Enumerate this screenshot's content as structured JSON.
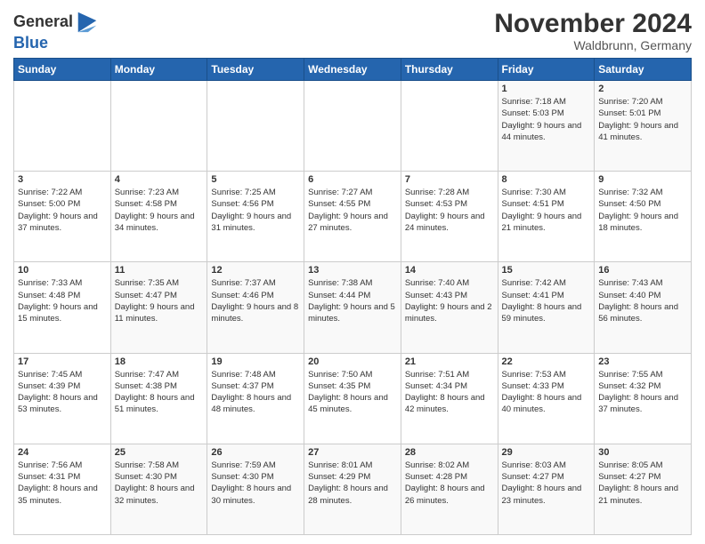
{
  "header": {
    "logo_line1": "General",
    "logo_line2": "Blue",
    "month": "November 2024",
    "location": "Waldbrunn, Germany"
  },
  "days_of_week": [
    "Sunday",
    "Monday",
    "Tuesday",
    "Wednesday",
    "Thursday",
    "Friday",
    "Saturday"
  ],
  "weeks": [
    [
      {
        "day": "",
        "info": ""
      },
      {
        "day": "",
        "info": ""
      },
      {
        "day": "",
        "info": ""
      },
      {
        "day": "",
        "info": ""
      },
      {
        "day": "",
        "info": ""
      },
      {
        "day": "1",
        "info": "Sunrise: 7:18 AM\nSunset: 5:03 PM\nDaylight: 9 hours and 44 minutes."
      },
      {
        "day": "2",
        "info": "Sunrise: 7:20 AM\nSunset: 5:01 PM\nDaylight: 9 hours and 41 minutes."
      }
    ],
    [
      {
        "day": "3",
        "info": "Sunrise: 7:22 AM\nSunset: 5:00 PM\nDaylight: 9 hours and 37 minutes."
      },
      {
        "day": "4",
        "info": "Sunrise: 7:23 AM\nSunset: 4:58 PM\nDaylight: 9 hours and 34 minutes."
      },
      {
        "day": "5",
        "info": "Sunrise: 7:25 AM\nSunset: 4:56 PM\nDaylight: 9 hours and 31 minutes."
      },
      {
        "day": "6",
        "info": "Sunrise: 7:27 AM\nSunset: 4:55 PM\nDaylight: 9 hours and 27 minutes."
      },
      {
        "day": "7",
        "info": "Sunrise: 7:28 AM\nSunset: 4:53 PM\nDaylight: 9 hours and 24 minutes."
      },
      {
        "day": "8",
        "info": "Sunrise: 7:30 AM\nSunset: 4:51 PM\nDaylight: 9 hours and 21 minutes."
      },
      {
        "day": "9",
        "info": "Sunrise: 7:32 AM\nSunset: 4:50 PM\nDaylight: 9 hours and 18 minutes."
      }
    ],
    [
      {
        "day": "10",
        "info": "Sunrise: 7:33 AM\nSunset: 4:48 PM\nDaylight: 9 hours and 15 minutes."
      },
      {
        "day": "11",
        "info": "Sunrise: 7:35 AM\nSunset: 4:47 PM\nDaylight: 9 hours and 11 minutes."
      },
      {
        "day": "12",
        "info": "Sunrise: 7:37 AM\nSunset: 4:46 PM\nDaylight: 9 hours and 8 minutes."
      },
      {
        "day": "13",
        "info": "Sunrise: 7:38 AM\nSunset: 4:44 PM\nDaylight: 9 hours and 5 minutes."
      },
      {
        "day": "14",
        "info": "Sunrise: 7:40 AM\nSunset: 4:43 PM\nDaylight: 9 hours and 2 minutes."
      },
      {
        "day": "15",
        "info": "Sunrise: 7:42 AM\nSunset: 4:41 PM\nDaylight: 8 hours and 59 minutes."
      },
      {
        "day": "16",
        "info": "Sunrise: 7:43 AM\nSunset: 4:40 PM\nDaylight: 8 hours and 56 minutes."
      }
    ],
    [
      {
        "day": "17",
        "info": "Sunrise: 7:45 AM\nSunset: 4:39 PM\nDaylight: 8 hours and 53 minutes."
      },
      {
        "day": "18",
        "info": "Sunrise: 7:47 AM\nSunset: 4:38 PM\nDaylight: 8 hours and 51 minutes."
      },
      {
        "day": "19",
        "info": "Sunrise: 7:48 AM\nSunset: 4:37 PM\nDaylight: 8 hours and 48 minutes."
      },
      {
        "day": "20",
        "info": "Sunrise: 7:50 AM\nSunset: 4:35 PM\nDaylight: 8 hours and 45 minutes."
      },
      {
        "day": "21",
        "info": "Sunrise: 7:51 AM\nSunset: 4:34 PM\nDaylight: 8 hours and 42 minutes."
      },
      {
        "day": "22",
        "info": "Sunrise: 7:53 AM\nSunset: 4:33 PM\nDaylight: 8 hours and 40 minutes."
      },
      {
        "day": "23",
        "info": "Sunrise: 7:55 AM\nSunset: 4:32 PM\nDaylight: 8 hours and 37 minutes."
      }
    ],
    [
      {
        "day": "24",
        "info": "Sunrise: 7:56 AM\nSunset: 4:31 PM\nDaylight: 8 hours and 35 minutes."
      },
      {
        "day": "25",
        "info": "Sunrise: 7:58 AM\nSunset: 4:30 PM\nDaylight: 8 hours and 32 minutes."
      },
      {
        "day": "26",
        "info": "Sunrise: 7:59 AM\nSunset: 4:30 PM\nDaylight: 8 hours and 30 minutes."
      },
      {
        "day": "27",
        "info": "Sunrise: 8:01 AM\nSunset: 4:29 PM\nDaylight: 8 hours and 28 minutes."
      },
      {
        "day": "28",
        "info": "Sunrise: 8:02 AM\nSunset: 4:28 PM\nDaylight: 8 hours and 26 minutes."
      },
      {
        "day": "29",
        "info": "Sunrise: 8:03 AM\nSunset: 4:27 PM\nDaylight: 8 hours and 23 minutes."
      },
      {
        "day": "30",
        "info": "Sunrise: 8:05 AM\nSunset: 4:27 PM\nDaylight: 8 hours and 21 minutes."
      }
    ]
  ]
}
